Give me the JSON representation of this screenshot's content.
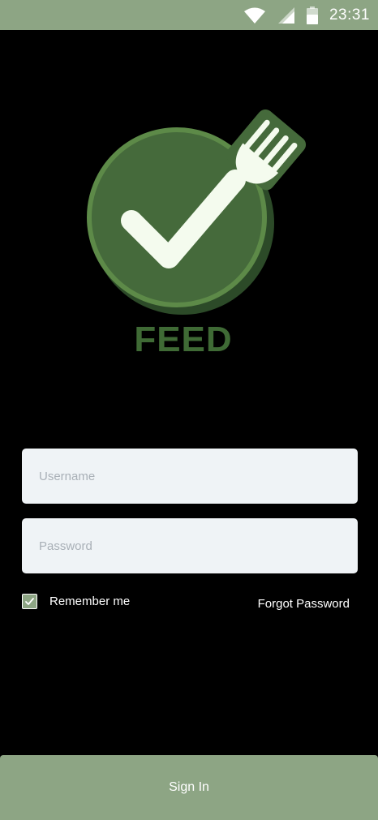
{
  "status_bar": {
    "time": "23:31",
    "icons": [
      "wifi-icon",
      "signal-icon",
      "battery-icon"
    ],
    "background": "#8da584"
  },
  "logo": {
    "text": "FEED",
    "icon": "check-fork-logo",
    "circle_color": "#456a3b",
    "shadow_color": "#2c4a28",
    "accent": "#5d8a48"
  },
  "form": {
    "username_placeholder": "Username",
    "password_placeholder": "Password",
    "remember_label": "Remember me",
    "remember_checked": true,
    "forgot_label": "Forgot Password"
  },
  "sign_in": {
    "label": "Sign In",
    "color": "#8da584"
  }
}
